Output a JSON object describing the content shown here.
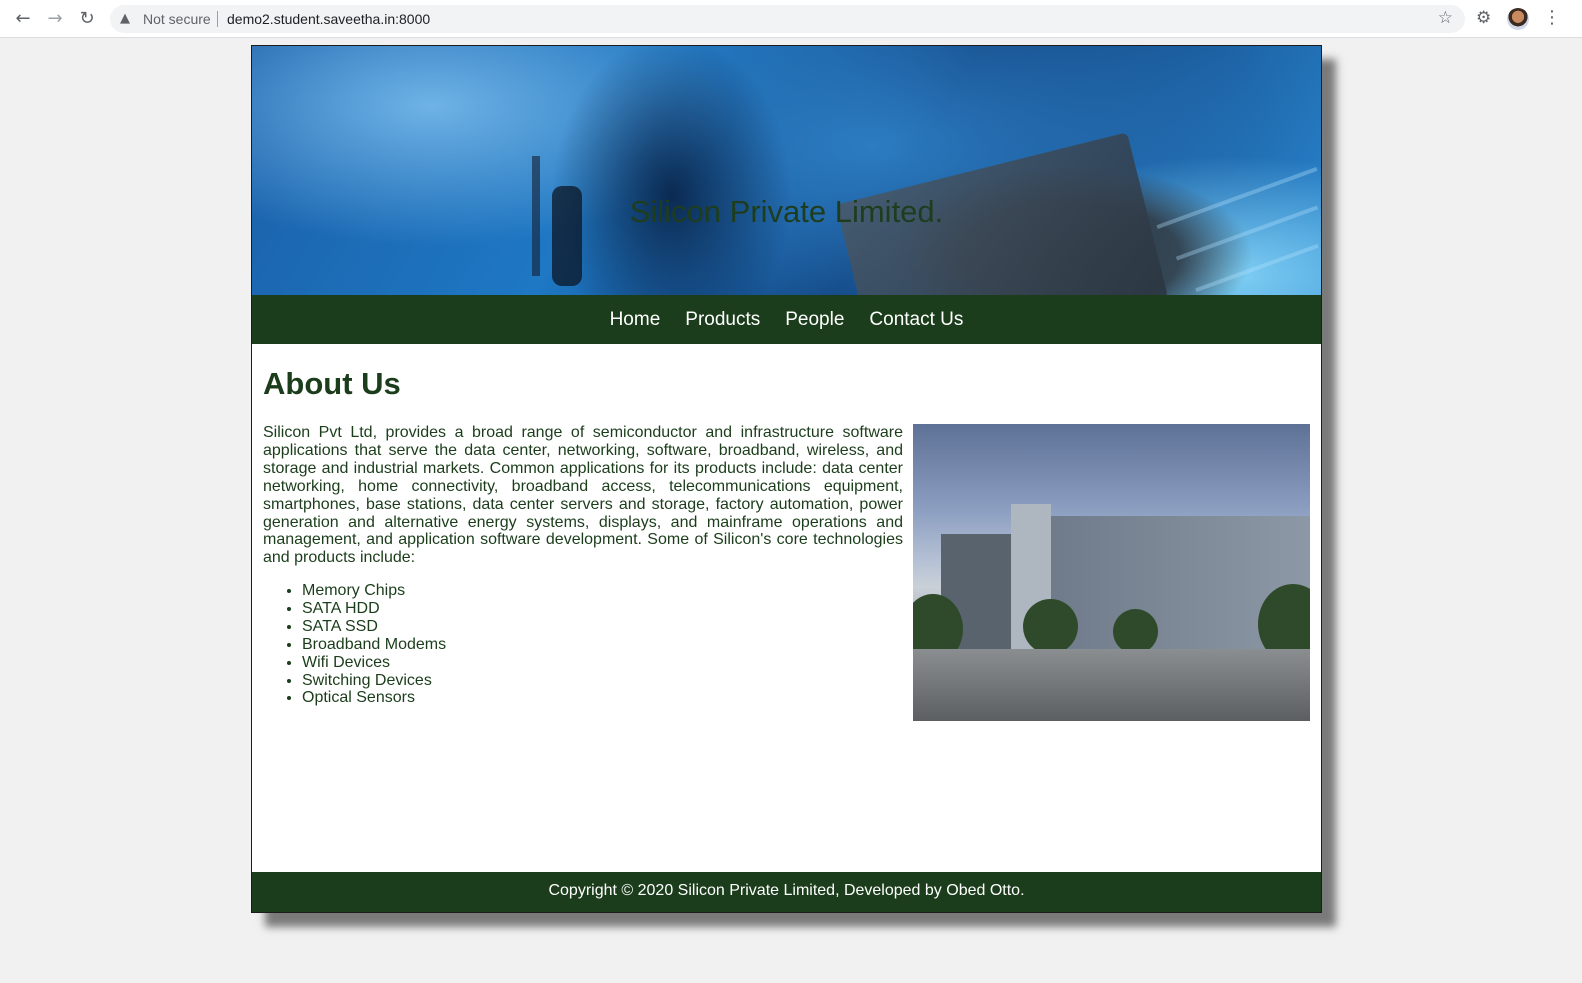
{
  "browser": {
    "back_icon": "arrow-left-icon",
    "forward_icon": "arrow-right-icon",
    "reload_icon": "reload-icon",
    "security_label": "Not secure",
    "url": "demo2.student.saveetha.in:8000"
  },
  "banner": {
    "title": "Silicon Private Limited."
  },
  "nav": {
    "items": [
      {
        "label": "Home"
      },
      {
        "label": "Products"
      },
      {
        "label": "People"
      },
      {
        "label": "Contact Us"
      }
    ]
  },
  "main": {
    "heading": "About Us",
    "intro": "Silicon Pvt Ltd, provides a broad range of semiconductor and infrastructure software applications that serve the data center, networking, software, broadband, wireless, and storage and industrial markets. Common applications for its products include: data center networking, home connectivity, broadband access, telecommunications equipment, smartphones, base stations, data center servers and storage, factory automation, power generation and alternative energy systems, displays, and mainframe operations and management, and application software development. Some of Silicon's core technologies and products include:",
    "products": [
      "Memory Chips",
      "SATA HDD",
      "SATA SSD",
      "Broadband Modems",
      "Wifi Devices",
      "Switching Devices",
      "Optical Sensors"
    ]
  },
  "footer": {
    "text": "Copyright © 2020 Silicon Private Limited, Developed by Obed Otto."
  },
  "colors": {
    "brand_green": "#1b3d1b",
    "page_background": "#f1f1f1"
  }
}
